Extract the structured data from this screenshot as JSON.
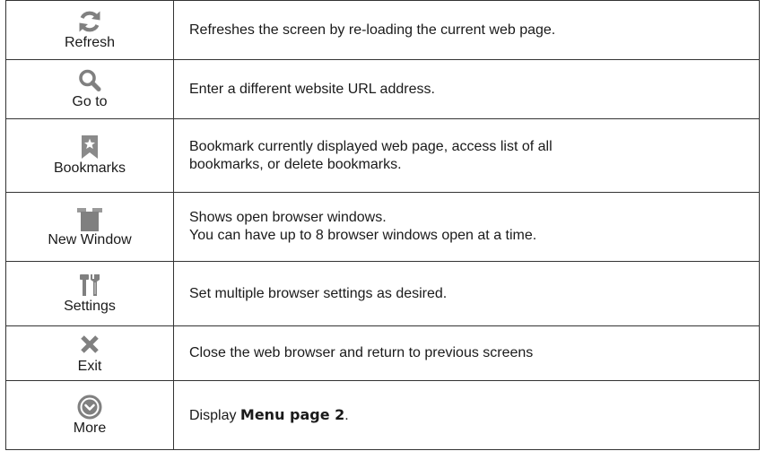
{
  "rows": [
    {
      "icon": "refresh-icon",
      "label": "Refresh",
      "description": "Refreshes the screen by re-loading the current web page."
    },
    {
      "icon": "magnifier-icon",
      "label": "Go to",
      "description": "Enter a different website URL address."
    },
    {
      "icon": "bookmark-star-icon",
      "label": "Bookmarks",
      "description_lines": [
        "Bookmark currently displayed web page, access list of all",
        "bookmarks, or delete bookmarks."
      ]
    },
    {
      "icon": "windows-icon",
      "label": "New Window",
      "description_lines": [
        "Shows open browser windows.",
        "You can have up to 8 browser windows open at a time."
      ]
    },
    {
      "icon": "tools-icon",
      "label": "Settings",
      "description": "Set multiple browser settings as desired."
    },
    {
      "icon": "close-x-icon",
      "label": "Exit",
      "description": "Close the web browser and return to previous screens"
    },
    {
      "icon": "chevron-down-circle-icon",
      "label": "More",
      "description_prefix": "Display ",
      "description_bold": "Menu page 2",
      "description_suffix": "."
    }
  ],
  "colors": {
    "icon_gray": "#808080",
    "border": "#333333",
    "text": "#1a1a1a"
  }
}
